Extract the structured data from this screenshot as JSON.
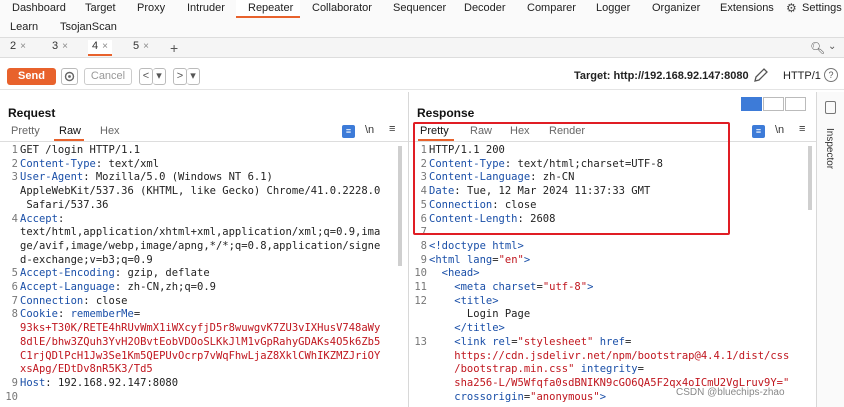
{
  "nav": {
    "row1": [
      "Dashboard",
      "Target",
      "Proxy",
      "Intruder",
      "Repeater",
      "Collaborator",
      "Sequencer",
      "Decoder",
      "Comparer",
      "Logger",
      "Organizer",
      "Extensions",
      "Settings"
    ],
    "row2": [
      "Learn",
      "TsojanScan"
    ]
  },
  "tabs": [
    {
      "label": "2",
      "x": "×"
    },
    {
      "label": "3",
      "x": "×"
    },
    {
      "label": "4",
      "x": "×"
    },
    {
      "label": "5",
      "x": "×"
    },
    {
      "label": "+"
    }
  ],
  "toolbar": {
    "send": "Send",
    "cancel": "Cancel",
    "back": "<",
    "back_dd": "▾",
    "fwd": ">",
    "fwd_dd": "▾",
    "target": "Target: http://192.168.92.147:8080",
    "http_version": "HTTP/1",
    "help": "?"
  },
  "request": {
    "title": "Request",
    "tabs": [
      "Pretty",
      "Raw",
      "Hex"
    ],
    "active_tab": "Raw",
    "newline_toggle": "\\n",
    "menu": "≡",
    "lines": [
      {
        "n": "1",
        "segs": [
          {
            "t": "GET /login HTTP/1.1",
            "c": ""
          }
        ]
      },
      {
        "n": "2",
        "segs": [
          {
            "t": "Content-Type",
            "c": "hn"
          },
          {
            "t": ": text/xml",
            "c": ""
          }
        ]
      },
      {
        "n": "3",
        "segs": [
          {
            "t": "User-Agent",
            "c": "hn"
          },
          {
            "t": ": Mozilla/5.0 (Windows NT 6.1)",
            "c": ""
          }
        ]
      },
      {
        "n": "",
        "segs": [
          {
            "t": "AppleWebKit/537.36 (KHTML, like Gecko) Chrome/41.0.2228.0",
            "c": ""
          }
        ]
      },
      {
        "n": "",
        "segs": [
          {
            "t": " Safari/537.36",
            "c": ""
          }
        ]
      },
      {
        "n": "4",
        "segs": [
          {
            "t": "Accept",
            "c": "hn"
          },
          {
            "t": ":",
            "c": ""
          }
        ]
      },
      {
        "n": "",
        "segs": [
          {
            "t": "text/html,application/xhtml+xml,application/xml;q=0.9,ima",
            "c": ""
          }
        ]
      },
      {
        "n": "",
        "segs": [
          {
            "t": "ge/avif,image/webp,image/apng,*/*;q=0.8,application/signe",
            "c": ""
          }
        ]
      },
      {
        "n": "",
        "segs": [
          {
            "t": "d-exchange;v=b3;q=0.9",
            "c": ""
          }
        ]
      },
      {
        "n": "5",
        "segs": [
          {
            "t": "Accept-Encoding",
            "c": "hn"
          },
          {
            "t": ": gzip, deflate",
            "c": ""
          }
        ]
      },
      {
        "n": "6",
        "segs": [
          {
            "t": "Accept-Language",
            "c": "hn"
          },
          {
            "t": ": zh-CN,zh;q=0.9",
            "c": ""
          }
        ]
      },
      {
        "n": "7",
        "segs": [
          {
            "t": "Connection",
            "c": "hn"
          },
          {
            "t": ": close",
            "c": ""
          }
        ]
      },
      {
        "n": "8",
        "segs": [
          {
            "t": "Cookie",
            "c": "hn"
          },
          {
            "t": ": ",
            "c": ""
          },
          {
            "t": "rememberMe",
            "c": "ckn"
          },
          {
            "t": "=",
            "c": ""
          }
        ]
      },
      {
        "n": "",
        "segs": [
          {
            "t": "93ks+T30K/RETE4hRUvWmX1iWXcyfjD5r8wuwgvK7ZU3vIXHusV748aWy",
            "c": "cv"
          }
        ]
      },
      {
        "n": "",
        "segs": [
          {
            "t": "8dlE/bhw3ZQuh3YvH2OBvtEobVDOoSLKkJlM1vGpRahyGDAKs4O5k6Zb5",
            "c": "cv"
          }
        ]
      },
      {
        "n": "",
        "segs": [
          {
            "t": "C1rjQDlPcH1Jw3Se1Km5QEPUvOcrp7vWqFhwLjaZ8XklCWhIKZMZJriOY",
            "c": "cv"
          }
        ]
      },
      {
        "n": "",
        "segs": [
          {
            "t": "xsApg/EDtDv8nR5K3/Td5",
            "c": "cv"
          }
        ]
      },
      {
        "n": "9",
        "segs": [
          {
            "t": "Host",
            "c": "hn"
          },
          {
            "t": ": 192.168.92.147:8080",
            "c": ""
          }
        ]
      },
      {
        "n": "10",
        "segs": [
          {
            "t": "",
            "c": ""
          }
        ]
      }
    ]
  },
  "response": {
    "title": "Response",
    "tabs": [
      "Pretty",
      "Raw",
      "Hex",
      "Render"
    ],
    "active_tab": "Pretty",
    "newline_toggle": "\\n",
    "menu": "≡",
    "lines": [
      {
        "n": "1",
        "segs": [
          {
            "t": "HTTP/1.1 200",
            "c": ""
          }
        ]
      },
      {
        "n": "2",
        "segs": [
          {
            "t": "Content-Type",
            "c": "hn"
          },
          {
            "t": ": text/html;charset=UTF-8",
            "c": ""
          }
        ]
      },
      {
        "n": "3",
        "segs": [
          {
            "t": "Content-Language",
            "c": "hn"
          },
          {
            "t": ": zh-CN",
            "c": ""
          }
        ]
      },
      {
        "n": "4",
        "segs": [
          {
            "t": "Date",
            "c": "hn"
          },
          {
            "t": ": Tue, 12 Mar 2024 11:37:33 GMT",
            "c": ""
          }
        ]
      },
      {
        "n": "5",
        "segs": [
          {
            "t": "Connection",
            "c": "hn"
          },
          {
            "t": ": close",
            "c": ""
          }
        ]
      },
      {
        "n": "6",
        "segs": [
          {
            "t": "Content-Length",
            "c": "hn"
          },
          {
            "t": ": 2608",
            "c": ""
          }
        ]
      },
      {
        "n": "7",
        "segs": [
          {
            "t": "",
            "c": ""
          }
        ]
      },
      {
        "n": "8",
        "segs": [
          {
            "t": "<!doctype html>",
            "c": "tag"
          }
        ]
      },
      {
        "n": "9",
        "segs": [
          {
            "t": "<html ",
            "c": "tag"
          },
          {
            "t": "lang",
            "c": "attr"
          },
          {
            "t": "=",
            "c": ""
          },
          {
            "t": "\"en\"",
            "c": "aval"
          },
          {
            "t": ">",
            "c": "tag"
          }
        ]
      },
      {
        "n": "10",
        "segs": [
          {
            "t": "  <head>",
            "c": "tag"
          }
        ]
      },
      {
        "n": "11",
        "segs": [
          {
            "t": "    <meta ",
            "c": "tag"
          },
          {
            "t": "charset",
            "c": "attr"
          },
          {
            "t": "=",
            "c": ""
          },
          {
            "t": "\"utf-8\"",
            "c": "aval"
          },
          {
            "t": ">",
            "c": "tag"
          }
        ]
      },
      {
        "n": "12",
        "segs": [
          {
            "t": "    <title>",
            "c": "tag"
          }
        ]
      },
      {
        "n": "",
        "segs": [
          {
            "t": "      Login Page",
            "c": ""
          }
        ]
      },
      {
        "n": "",
        "segs": [
          {
            "t": "    </title>",
            "c": "tag"
          }
        ]
      },
      {
        "n": "13",
        "segs": [
          {
            "t": "    <link ",
            "c": "tag"
          },
          {
            "t": "rel",
            "c": "attr"
          },
          {
            "t": "=",
            "c": ""
          },
          {
            "t": "\"stylesheet\"",
            "c": "aval"
          },
          {
            "t": " href",
            "c": "attr"
          },
          {
            "t": "=",
            "c": ""
          }
        ]
      },
      {
        "n": "",
        "segs": [
          {
            "t": "    https://cdn.jsdelivr.net/npm/bootstrap@4.4.1/dist/css",
            "c": "aval"
          }
        ]
      },
      {
        "n": "",
        "segs": [
          {
            "t": "    /bootstrap.min.css\"",
            "c": "aval"
          },
          {
            "t": " integrity",
            "c": "attr"
          },
          {
            "t": "=",
            "c": ""
          }
        ]
      },
      {
        "n": "",
        "segs": [
          {
            "t": "    sha256-L/W5Wfqfa0sdBNIKN9cGO6QA5F2qx4oICmU2VgLruv9Y=\"",
            "c": "aval"
          }
        ]
      },
      {
        "n": "",
        "segs": [
          {
            "t": "    crossorigin",
            "c": "attr"
          },
          {
            "t": "=",
            "c": ""
          },
          {
            "t": "\"anonymous\"",
            "c": "aval"
          },
          {
            "t": ">",
            "c": "tag"
          }
        ]
      }
    ]
  },
  "inspector": {
    "label": "Inspector"
  },
  "watermark": "CSDN @bluechips-zhao",
  "colors": {
    "accent": "#e8622c",
    "blue": "#3d7bd8",
    "highlight_border": "#e01d24"
  }
}
